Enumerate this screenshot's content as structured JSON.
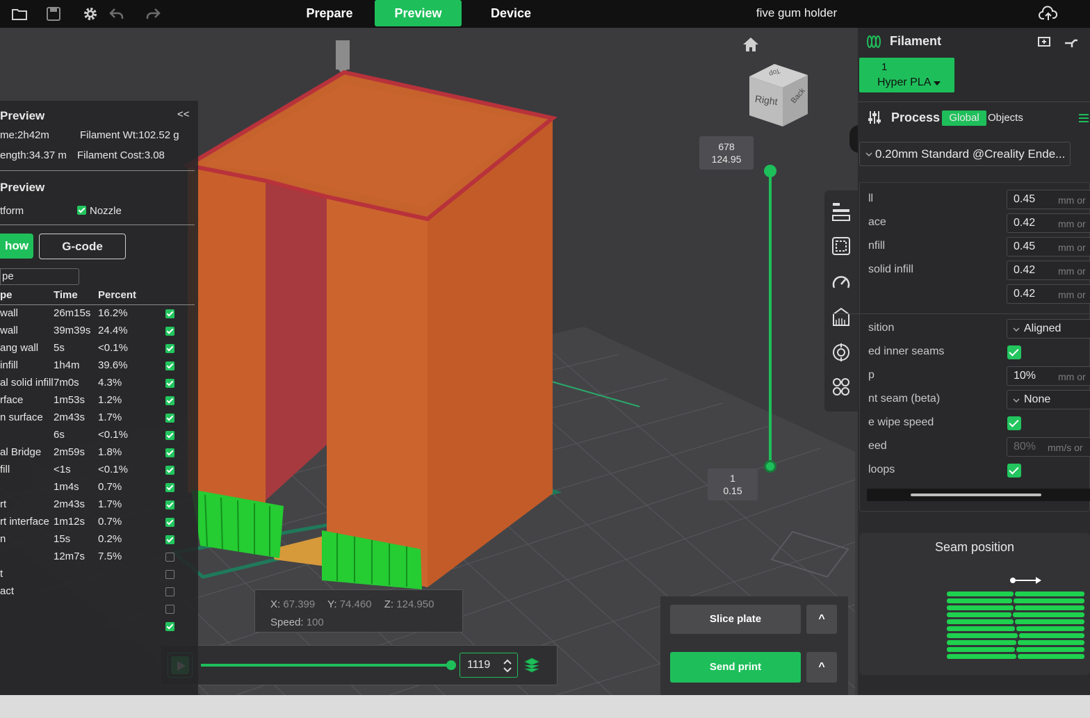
{
  "toolbar": {
    "icons": [
      "open-folder-icon",
      "save-icon",
      "settings-gear-icon",
      "undo-icon",
      "redo-icon"
    ],
    "tabs": [
      "Prepare",
      "Preview",
      "Device"
    ],
    "active_tab": "Preview",
    "document_title": "five gum holder",
    "upload_icon": "cloud-upload-icon"
  },
  "legend": {
    "title": "Preview",
    "collapse_label": "<<",
    "time": "me:2h42m",
    "filament_weight": "Filament Wt:102.52 g",
    "length": "ength:34.37 m",
    "filament_cost": "Filament Cost:3.08",
    "view_title": "Preview",
    "platform_label": "tform",
    "nozzle_label": "Nozzle",
    "show_button": "how",
    "gcode_button": "G-code",
    "filter_value": "pe",
    "columns": [
      "pe",
      "Time",
      "Percent"
    ],
    "rows": [
      {
        "name": "wall",
        "time": "26m15s",
        "percent": "16.2%",
        "checked": true
      },
      {
        "name": "wall",
        "time": "39m39s",
        "percent": "24.4%",
        "checked": true
      },
      {
        "name": "ang wall",
        "time": "5s",
        "percent": "<0.1%",
        "checked": true
      },
      {
        "name": " infill",
        "time": "1h4m",
        "percent": "39.6%",
        "checked": true
      },
      {
        "name": "al solid infill",
        "time": "7m0s",
        "percent": "4.3%",
        "checked": true
      },
      {
        "name": "rface",
        "time": "1m53s",
        "percent": "1.2%",
        "checked": true
      },
      {
        "name": "n surface",
        "time": "2m43s",
        "percent": "1.7%",
        "checked": true
      },
      {
        "name": "",
        "time": "6s",
        "percent": "<0.1%",
        "checked": true
      },
      {
        "name": "al Bridge",
        "time": "2m59s",
        "percent": "1.8%",
        "checked": true
      },
      {
        "name": "fill",
        "time": "<1s",
        "percent": "<0.1%",
        "checked": true
      },
      {
        "name": "",
        "time": "1m4s",
        "percent": "0.7%",
        "checked": true
      },
      {
        "name": "rt",
        "time": "2m43s",
        "percent": "1.7%",
        "checked": true
      },
      {
        "name": "rt interface",
        "time": "1m12s",
        "percent": "0.7%",
        "checked": true
      },
      {
        "name": "n",
        "time": "15s",
        "percent": "0.2%",
        "checked": true
      },
      {
        "name": "",
        "time": "12m7s",
        "percent": "7.5%",
        "checked": false
      },
      {
        "name": "t",
        "time": "",
        "percent": "",
        "checked": false
      },
      {
        "name": "act",
        "time": "",
        "percent": "",
        "checked": false
      },
      {
        "name": "",
        "time": "",
        "percent": "",
        "checked": false
      },
      {
        "name": "",
        "time": "",
        "percent": "",
        "checked": true
      }
    ]
  },
  "viewport": {
    "home_icon": "home-icon",
    "view_cube": {
      "top": "Top",
      "right": "Right",
      "back": "Back"
    },
    "layer_top": {
      "layer": "678",
      "height": "124.95"
    },
    "layer_bottom": {
      "layer": "1",
      "height": "0.15"
    },
    "side_tools": [
      "layers-icon",
      "select-box-icon",
      "speed-gauge-icon",
      "paint-support-icon",
      "seam-target-icon",
      "assembly-icon"
    ],
    "coords": {
      "x_label": "X:",
      "x": "67.399",
      "y_label": "Y:",
      "y": "74.460",
      "z_label": "Z:",
      "z": "124.950",
      "speed_label": "Speed:",
      "speed": "100"
    },
    "playback": {
      "move_value": "1119",
      "progress": 1.0
    },
    "slice_button": "Slice plate",
    "send_button": "Send print",
    "expand_label": "^"
  },
  "right_panel": {
    "filament_title": "Filament",
    "filament_slot": "1",
    "filament_name": "Hyper PLA",
    "process_title": "Process",
    "global_tab": "Global",
    "objects_tab": "Objects",
    "profile": "0.20mm Standard @Creality Ende...",
    "settings": [
      {
        "label": "ll",
        "value": "0.45",
        "unit": "mm or",
        "kind": "input"
      },
      {
        "label": "ace",
        "value": "0.42",
        "unit": "mm or",
        "kind": "input"
      },
      {
        "label": "nfill",
        "value": "0.45",
        "unit": "mm or",
        "kind": "input"
      },
      {
        "label": "solid infill",
        "value": "0.42",
        "unit": "mm or",
        "kind": "input"
      },
      {
        "label": "",
        "value": "0.42",
        "unit": "mm or",
        "kind": "input"
      },
      {
        "label": "sition",
        "value": "Aligned",
        "unit": "",
        "kind": "select"
      },
      {
        "label": "ed inner seams",
        "value": "",
        "unit": "",
        "kind": "check"
      },
      {
        "label": "p",
        "value": "10%",
        "unit": "mm or",
        "kind": "input"
      },
      {
        "label": "nt seam (beta)",
        "value": "None",
        "unit": "",
        "kind": "select"
      },
      {
        "label": "e wipe speed",
        "value": "",
        "unit": "",
        "kind": "check"
      },
      {
        "label": "eed",
        "value": "80%",
        "unit": "mm/s or",
        "kind": "input-disabled"
      },
      {
        "label": " loops",
        "value": "",
        "unit": "",
        "kind": "check"
      }
    ],
    "tooltip_title": "Seam position"
  },
  "colors": {
    "accent": "#1ebf5a",
    "wall": "#c8602a",
    "wall_top": "#b3343f",
    "support": "#22c930"
  }
}
